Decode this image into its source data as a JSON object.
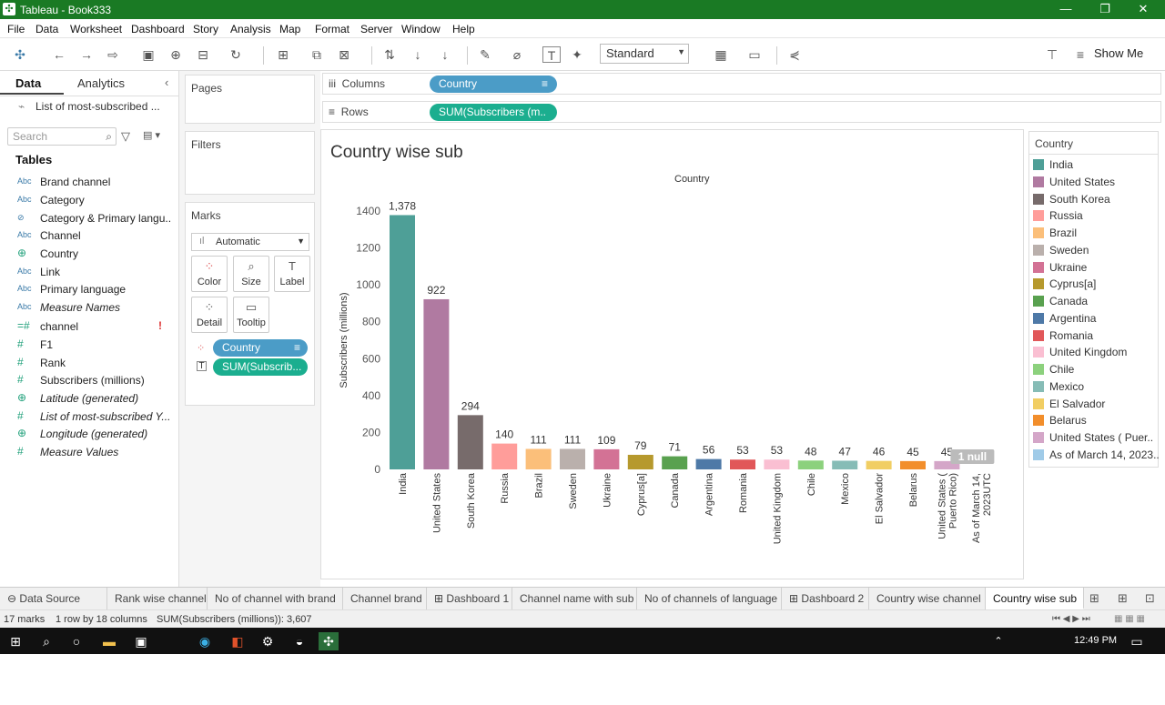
{
  "window": {
    "title": "Tableau - Book333",
    "min": "—",
    "restore": "❐",
    "close": "✕"
  },
  "menu": [
    "File",
    "Data",
    "Worksheet",
    "Dashboard",
    "Story",
    "Analysis",
    "Map",
    "Format",
    "Server",
    "Window",
    "Help"
  ],
  "toolbar": {
    "standard": "Standard",
    "show_me": "Show Me"
  },
  "left_panel": {
    "tab_data": "Data",
    "tab_analytics": "Analytics",
    "datasource": "List of most-subscribed ...",
    "search_placeholder": "Search",
    "tables_heading": "Tables",
    "fields": [
      {
        "icon": "Abc",
        "name": "Brand channel",
        "italic": false
      },
      {
        "icon": "Abc",
        "name": "Category",
        "italic": false
      },
      {
        "icon": "link",
        "name": "Category & Primary langu...",
        "italic": false
      },
      {
        "icon": "Abc",
        "name": "Channel",
        "italic": false
      },
      {
        "icon": "globe",
        "name": "Country",
        "italic": false
      },
      {
        "icon": "Abc",
        "name": "Link",
        "italic": false
      },
      {
        "icon": "Abc",
        "name": "Primary language",
        "italic": false
      },
      {
        "icon": "Abc",
        "name": "Measure Names",
        "italic": true
      },
      {
        "icon": "=#",
        "name": "channel",
        "italic": false
      },
      {
        "icon": "#",
        "name": "F1",
        "italic": false
      },
      {
        "icon": "#",
        "name": "Rank",
        "italic": false
      },
      {
        "icon": "#",
        "name": "Subscribers (millions)",
        "italic": false
      },
      {
        "icon": "globe",
        "name": "Latitude (generated)",
        "italic": true
      },
      {
        "icon": "#",
        "name": "List of most-subscribed Y...",
        "italic": true
      },
      {
        "icon": "globe",
        "name": "Longitude (generated)",
        "italic": true
      },
      {
        "icon": "#",
        "name": "Measure Values",
        "italic": true
      }
    ]
  },
  "cards": {
    "pages": "Pages",
    "filters": "Filters",
    "marks": "Marks",
    "mark_type": "Automatic",
    "buttons": [
      "Color",
      "Size",
      "Label",
      "Detail",
      "Tooltip"
    ],
    "pill_country": "Country",
    "pill_sum": "SUM(Subscrib..."
  },
  "shelves": {
    "columns_label": "Columns",
    "rows_label": "Rows",
    "columns_pill": "Country",
    "rows_pill": "SUM(Subscribers (m.."
  },
  "chart_data": {
    "type": "bar",
    "title": "Country wise sub",
    "header": "Country",
    "ylabel": "Subscribers (millions)",
    "ylim": [
      0,
      1400
    ],
    "yticks": [
      0,
      200,
      400,
      600,
      800,
      1000,
      1200,
      1400
    ],
    "categories": [
      "India",
      "United States",
      "South Korea",
      "Russia",
      "Brazil",
      "Sweden",
      "Ukraine",
      "Cyprus[a]",
      "Canada",
      "Argentina",
      "Romania",
      "United Kingdom",
      "Chile",
      "Mexico",
      "El Salvador",
      "Belarus",
      "United States (\nPuerto Rico)",
      "As of March 14,\n2023UTC"
    ],
    "values": [
      1378,
      922,
      294,
      140,
      111,
      111,
      109,
      79,
      71,
      56,
      53,
      53,
      48,
      47,
      46,
      45,
      45,
      null
    ],
    "labels": [
      "1,378",
      "922",
      "294",
      "140",
      "111",
      "111",
      "109",
      "79",
      "71",
      "56",
      "53",
      "53",
      "48",
      "47",
      "46",
      "45",
      "45",
      ""
    ],
    "colors": [
      "#4e9f97",
      "#b07aa1",
      "#776b6b",
      "#ff9d9a",
      "#fbbf7a",
      "#bab0ac",
      "#d37295",
      "#b6992d",
      "#59a14f",
      "#4e79a7",
      "#e15759",
      "#fabfd2",
      "#8cd17d",
      "#86bcb6",
      "#f1ce63",
      "#f28e2b",
      "#d4a6c8",
      "#a0cbe8"
    ],
    "null_badge": "1 null"
  },
  "legend": {
    "title": "Country",
    "items": [
      "India",
      "United States",
      "South Korea",
      "Russia",
      "Brazil",
      "Sweden",
      "Ukraine",
      "Cyprus[a]",
      "Canada",
      "Argentina",
      "Romania",
      "United Kingdom",
      "Chile",
      "Mexico",
      "El Salvador",
      "Belarus",
      "United States ( Puer..",
      "As of March 14, 2023.."
    ]
  },
  "sheet_tabs": [
    "Data Source",
    "Rank wise channel",
    "No of channel with brand",
    "Channel brand",
    "Dashboard 1",
    "Channel name with sub",
    "No of channels of language",
    "Dashboard 2",
    "Country wise channel",
    "Country wise sub"
  ],
  "status": {
    "marks": "17 marks",
    "dims": "1 row by 18 columns",
    "sum": "SUM(Subscribers (millions)): 3,607"
  },
  "taskbar": {
    "time": "12:49 PM"
  }
}
